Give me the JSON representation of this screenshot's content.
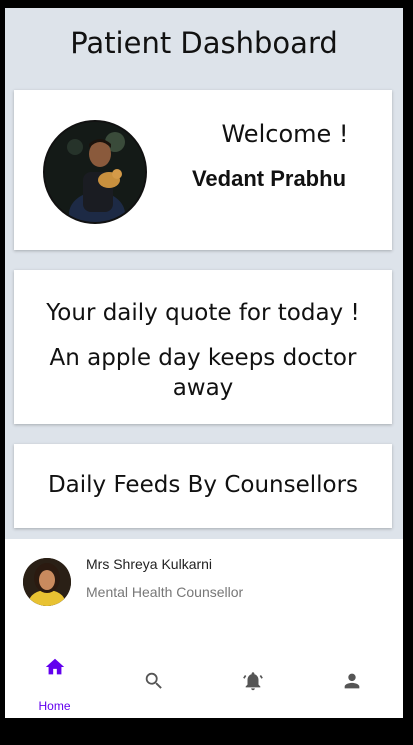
{
  "header": {
    "title": "Patient Dashboard"
  },
  "welcome_card": {
    "greeting": "Welcome !",
    "user_name": "Vedant Prabhu"
  },
  "quote_card": {
    "heading": "Your daily quote for today !",
    "quote": "An apple day keeps doctor away"
  },
  "feeds_card": {
    "heading": "Daily Feeds By Counsellors"
  },
  "counsellors": [
    {
      "name": "Mrs Shreya Kulkarni",
      "role": "Mental Health Counsellor"
    }
  ],
  "bottom_nav": {
    "items": [
      {
        "label": "Home",
        "icon": "home-icon",
        "active": true
      },
      {
        "label": "",
        "icon": "search-icon",
        "active": false
      },
      {
        "label": "",
        "icon": "notification-bell-icon",
        "active": false
      },
      {
        "label": "",
        "icon": "profile-icon",
        "active": false
      }
    ],
    "active_color": "#6200ee",
    "inactive_color": "#555555"
  },
  "colors": {
    "background": "#dde3ea",
    "card": "#ffffff"
  }
}
